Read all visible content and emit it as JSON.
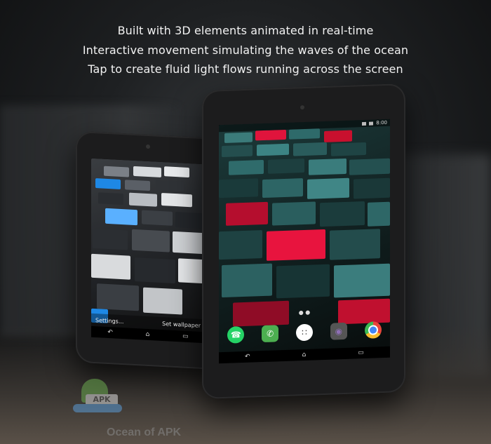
{
  "headlines": [
    "Built with 3D elements animated in real-time",
    "Interactive movement simulating the waves of the ocean",
    "Tap to create fluid light flows running across the screen"
  ],
  "back_tablet": {
    "actions": {
      "settings_label": "Settings...",
      "set_wallpaper_label": "Set wallpaper"
    },
    "nav": {
      "back_icon": "↶",
      "home_icon": "⌂",
      "recents_icon": "▭"
    }
  },
  "front_tablet": {
    "status": {
      "time": "8:00"
    },
    "dock_apps": [
      {
        "name": "whatsapp-icon",
        "glyph": "☎",
        "color": "#25d366"
      },
      {
        "name": "phone-icon",
        "glyph": "✆",
        "color": "#4caf50"
      },
      {
        "name": "app-drawer-icon",
        "glyph": "∷",
        "color": "#ffffff"
      },
      {
        "name": "camera-icon",
        "glyph": "◉",
        "color": "#8e6fb5"
      },
      {
        "name": "chrome-icon",
        "glyph": "●",
        "color": "#e8453c"
      }
    ],
    "nav": {
      "back_icon": "↶",
      "home_icon": "⌂",
      "recents_icon": "▭"
    }
  },
  "watermark": {
    "badge": "APK",
    "text": "Ocean of APK"
  },
  "colors": {
    "accent_red": "#e0143c",
    "accent_blue": "#1e88e5",
    "teal": "#2e6a6a"
  }
}
